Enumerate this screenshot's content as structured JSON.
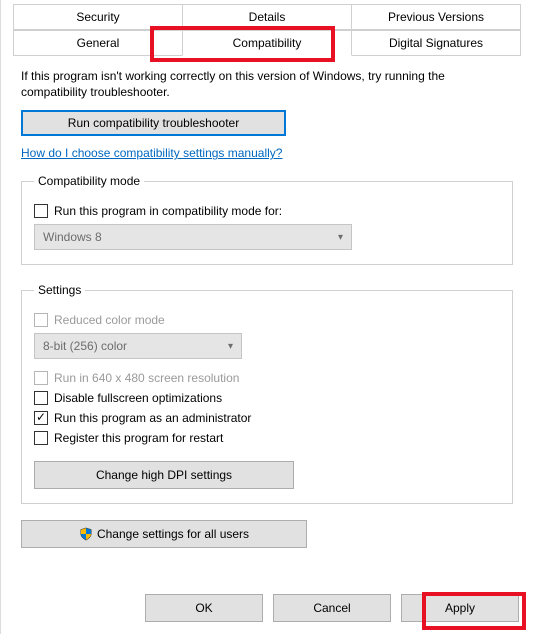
{
  "tabs": {
    "row1": [
      "Security",
      "Details",
      "Previous Versions"
    ],
    "row2": [
      "General",
      "Compatibility",
      "Digital Signatures"
    ],
    "active": "Compatibility"
  },
  "intro": "If this program isn't working correctly on this version of Windows, try running the compatibility troubleshooter.",
  "troubleshoot_btn": "Run compatibility troubleshooter",
  "help_link": "How do I choose compatibility settings manually?",
  "compat_group": {
    "legend": "Compatibility mode",
    "checkbox_label": "Run this program in compatibility mode for:",
    "select_value": "Windows 8"
  },
  "settings_group": {
    "legend": "Settings",
    "reduced_color": "Reduced color mode",
    "color_select": "8-bit (256) color",
    "run_640": "Run in 640 x 480 screen resolution",
    "disable_fullscreen": "Disable fullscreen optimizations",
    "run_admin": "Run this program as an administrator",
    "register_restart": "Register this program for restart",
    "dpi_btn": "Change high DPI settings"
  },
  "all_users_btn": "Change settings for all users",
  "footer": {
    "ok": "OK",
    "cancel": "Cancel",
    "apply": "Apply"
  }
}
